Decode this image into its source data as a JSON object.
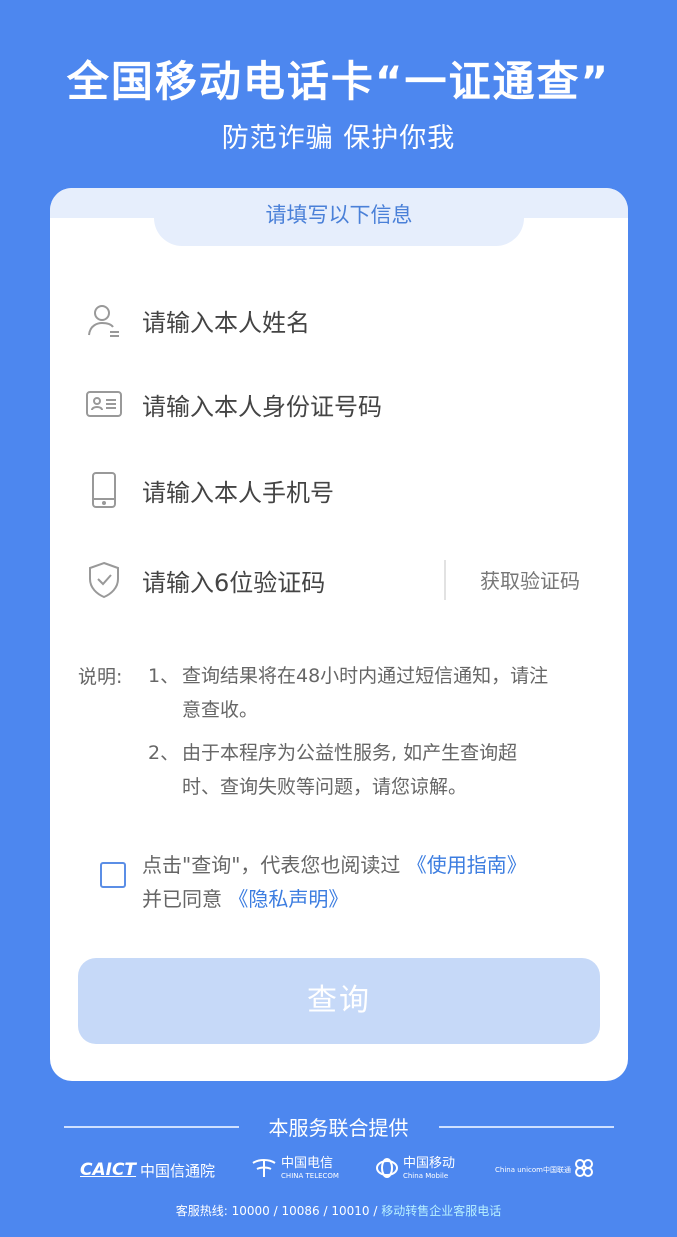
{
  "header": {
    "title": "全国移动电话卡“一证通查”",
    "subtitle": "防范诈骗 保护你我"
  },
  "form": {
    "section_label": "请填写以下信息",
    "name_placeholder": "请输入本人姓名",
    "id_placeholder": "请输入本人身份证号码",
    "phone_placeholder": "请输入本人手机号",
    "code_placeholder": "请输入6位验证码",
    "get_code_label": "获取验证码"
  },
  "notes": {
    "label": "说明:",
    "items": [
      {
        "num": "1、",
        "line1": "查询结果将在48小时内通过短信通知，请注",
        "line2": "意查收。"
      },
      {
        "num": "2、",
        "line1": "由于本程序为公益性服务, 如产生查询超",
        "line2": "时、查询失败等问题，请您谅解。"
      }
    ]
  },
  "agreement": {
    "text1": "点击\"查询\"，代表您也阅读过",
    "link1": "《使用指南》",
    "text2": "并已同意",
    "link2": "《隐私声明》",
    "checked": false
  },
  "submit_label": "查询",
  "footer": {
    "provided_by": "本服务联合提供",
    "logos": {
      "caict_abbr": "CAICT",
      "caict_name": "中国信通院",
      "telecom_name": "中国电信",
      "telecom_en": "CHINA TELECOM",
      "mobile_name": "中国移动",
      "mobile_en": "China Mobile",
      "unicom_en": "China unicom中国联通"
    },
    "hotline": "客服热线: 10000 / 10086 / 10010 /",
    "hotline_link": "移动转售企业客服电话"
  },
  "colors": {
    "background": "#4d87ef",
    "accent": "#3c7de0",
    "button_disabled": "#c6d9f8"
  }
}
